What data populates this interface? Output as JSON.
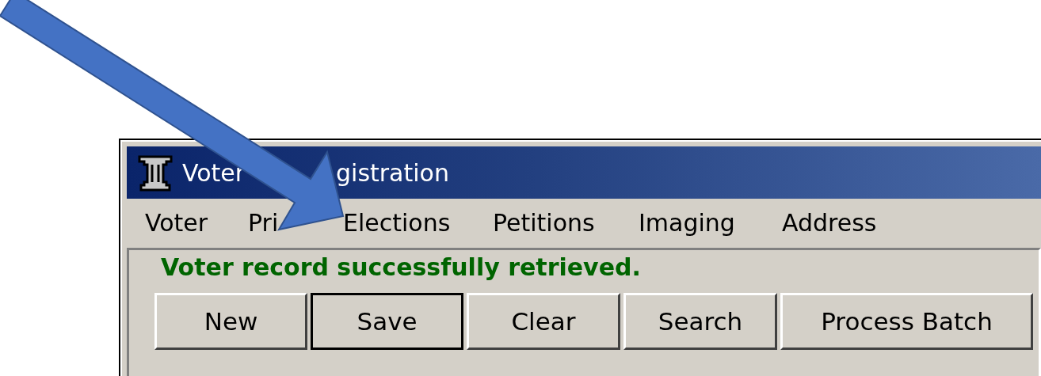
{
  "window": {
    "title_parts": [
      "Voter",
      "gistration"
    ]
  },
  "menu": [
    {
      "label": "Voter"
    },
    {
      "label": "Pri"
    },
    {
      "label": "Elections"
    },
    {
      "label": "Petitions"
    },
    {
      "label": "Imaging"
    },
    {
      "label": "Address"
    }
  ],
  "status_message": "Voter record successfully retrieved.",
  "buttons": [
    {
      "label": "New",
      "focused": false
    },
    {
      "label": "Save",
      "focused": true
    },
    {
      "label": "Clear",
      "focused": false
    },
    {
      "label": "Search",
      "focused": false
    },
    {
      "label": "Process Batch",
      "focused": false
    }
  ]
}
